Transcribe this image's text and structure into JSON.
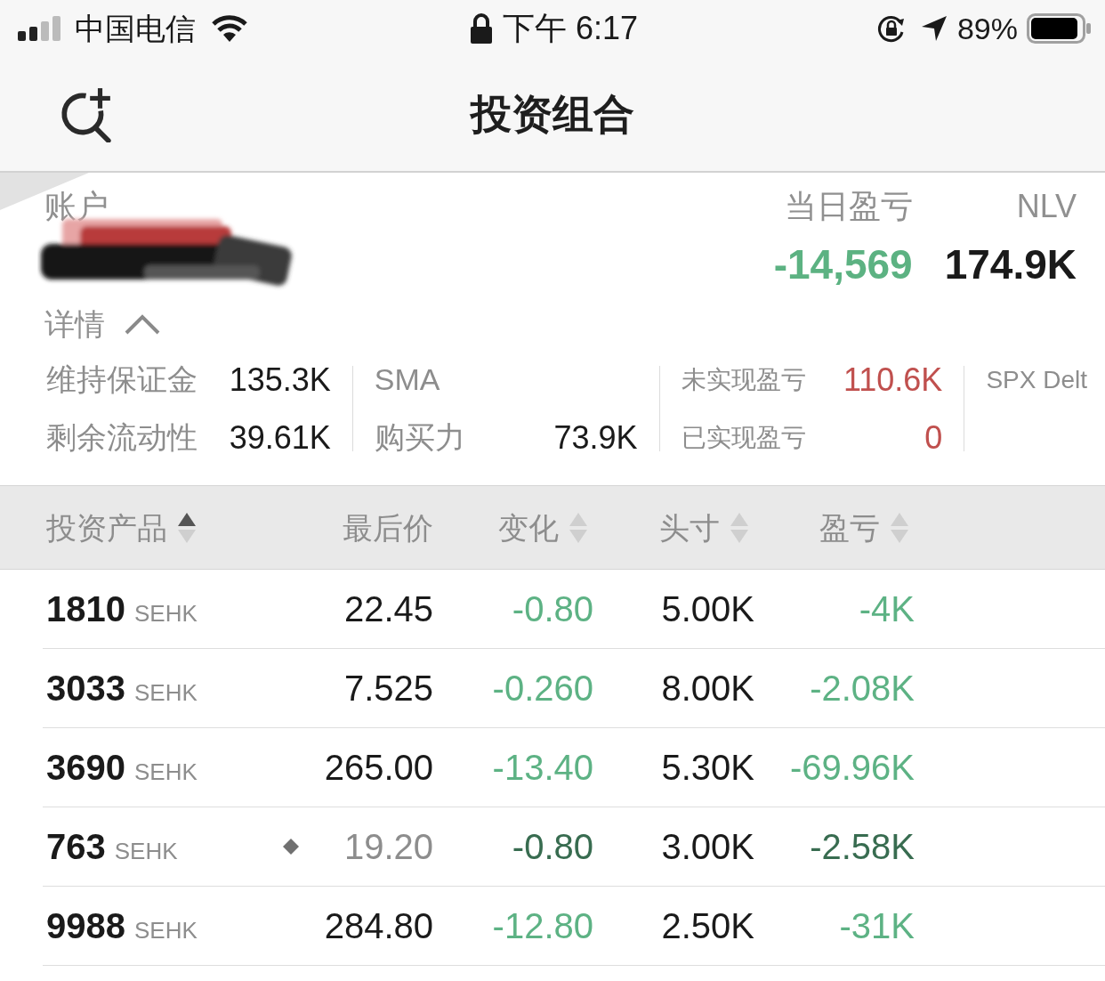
{
  "status_bar": {
    "carrier": "中国电信",
    "time": "下午 6:17",
    "battery": "89%"
  },
  "nav_bar": {
    "title": "投资组合"
  },
  "account": {
    "label": "账户",
    "day_pnl_label": "当日盈亏",
    "day_pnl": "-14,569",
    "nlv_label": "NLV",
    "nlv": "174.9K",
    "details_label": "详情",
    "details_expanded": true
  },
  "metrics": [
    {
      "kind": "standard",
      "items": [
        {
          "label": "维持保证金",
          "value": "135.3K"
        },
        {
          "label": "剩余流动性",
          "value": "39.61K"
        }
      ]
    },
    {
      "kind": "standard",
      "items": [
        {
          "label": "SMA"
        },
        {
          "label": "购买力",
          "value": "73.9K"
        }
      ]
    },
    {
      "kind": "pnl",
      "items": [
        {
          "label": "未实现盈亏",
          "value": "110.6K"
        },
        {
          "label": "已实现盈亏",
          "value": "0"
        }
      ]
    },
    {
      "kind": "delta",
      "items": [
        {
          "label": "SPX Delt"
        }
      ]
    }
  ],
  "table": {
    "columns": [
      {
        "label": "投资产品",
        "sorted": true
      },
      {
        "label": "最后价"
      },
      {
        "label": "变化",
        "sorted": false
      },
      {
        "label": "头寸",
        "sorted": false
      },
      {
        "label": "盈亏",
        "sorted": false
      }
    ],
    "rows": [
      {
        "symbol": "1810",
        "exchange": "SEHK",
        "price": "22.45",
        "flagged": false,
        "change": "-0.80",
        "position": "5.00K",
        "pnl": "-4K",
        "color": "#5db284"
      },
      {
        "symbol": "3033",
        "exchange": "SEHK",
        "price": "7.525",
        "flagged": false,
        "change": "-0.260",
        "position": "8.00K",
        "pnl": "-2.08K",
        "color": "#5db284"
      },
      {
        "symbol": "3690",
        "exchange": "SEHK",
        "price": "265.00",
        "flagged": false,
        "change": "-13.40",
        "position": "5.30K",
        "pnl": "-69.96K",
        "color": "#5db284"
      },
      {
        "symbol": "763",
        "exchange": "SEHK",
        "price": "19.20",
        "flagged": true,
        "change": "-0.80",
        "position": "3.00K",
        "pnl": "-2.58K",
        "color": "#386c50"
      },
      {
        "symbol": "9988",
        "exchange": "SEHK",
        "price": "284.80",
        "flagged": false,
        "change": "-12.80",
        "position": "2.50K",
        "pnl": "-31K",
        "color": "#5db284"
      }
    ]
  }
}
